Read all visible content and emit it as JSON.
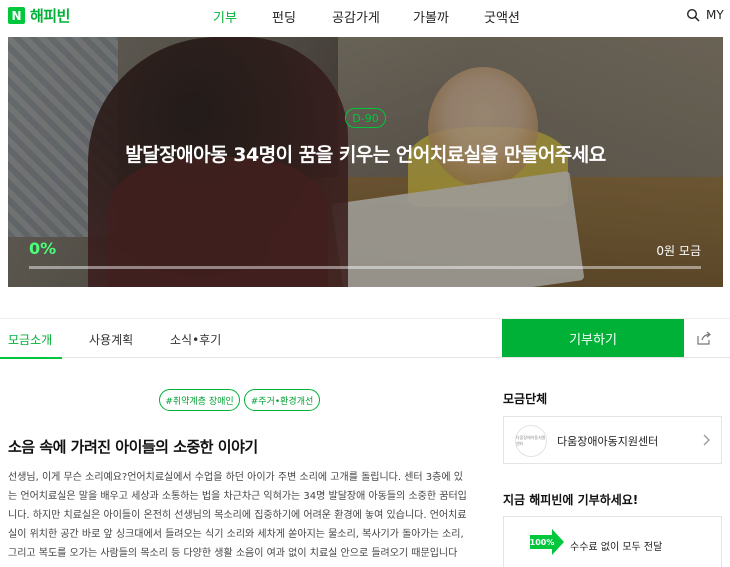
{
  "header": {
    "logo_letter": "N",
    "logo_text": "해피빈",
    "nav": [
      "기부",
      "펀딩",
      "공감가게",
      "가볼까",
      "굿액션"
    ],
    "my_label": "MY"
  },
  "hero": {
    "dday": "D-90",
    "title": "발달장애아동 34명이 꿈을 키우는 언어치료실을 만들어주세요",
    "progress_percent": "0%",
    "progress_value": 0,
    "raised_label": "0원 모금"
  },
  "tabs": [
    "모금소개",
    "사용계획",
    "소식•후기"
  ],
  "donate_button": "기부하기",
  "tags": [
    "#취약계층 장애인",
    "#주거•환경개선"
  ],
  "story": {
    "title": "소음 속에 가려진 아이들의 소중한 이야기",
    "lines": [
      "선생님, 이게 무슨 소리예요?언어치료실에서 수업을 하던 아이가 주변 소리에 고개를 돌립니다. 센터 3층에 있",
      "는 언어치료실은 말을 배우고 세상과 소통하는 법을 차근차근 익혀가는 34명 발달장애 아동들의 소중한 꿈터입",
      "니다. 하지만 치료실은 아이들이 온전히 선생님의 목소리에 집중하기에 어려운 환경에 놓여 있습니다. 언어치료",
      "실이 위치한 공간 바로 앞 싱크대에서 들려오는 식기 소리와 세차게 쏟아지는 물소리, 복사기가 돌아가는 소리,",
      "그리고 복도를 오가는 사람들의 목소리 등 다양한 생활 소음이 여과 없이 치료실 안으로 들려오기 때문입니다"
    ]
  },
  "sidebar": {
    "org_heading": "모금단체",
    "org_logo_text": "다움장애아동지원센터",
    "org_name": "다움장애아동지원센터",
    "donate_heading": "지금 해피빈에 기부하세요!",
    "fee_badge": "100%",
    "fee_text": "수수료 없이 모두 전달"
  },
  "colors": {
    "brand_green": "#00b137",
    "accent_green": "#00c73c"
  },
  "icons": {
    "search": "search-icon",
    "share": "share-icon",
    "chevron": "chevron-right-icon"
  }
}
